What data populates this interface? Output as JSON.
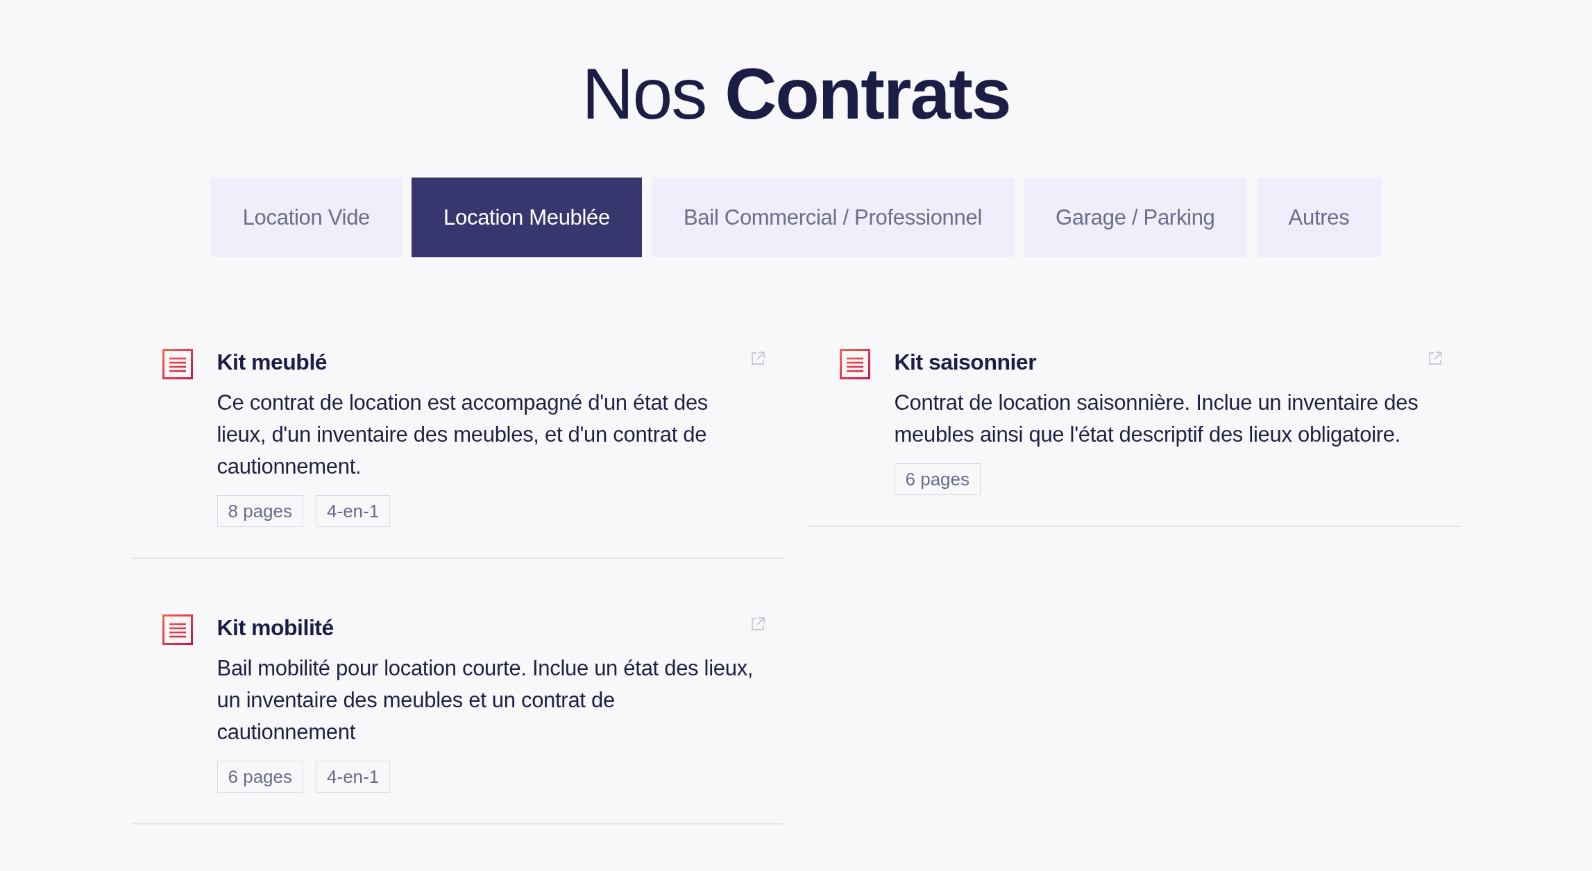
{
  "page": {
    "title": "Nos **Contrats**"
  },
  "tabs": [
    {
      "label": "Location Vide",
      "selected": false
    },
    {
      "label": "Location Meublée",
      "selected": true
    },
    {
      "label": "Bail Commercial / Professionnel",
      "selected": false
    },
    {
      "label": "Garage / Parking",
      "selected": false
    },
    {
      "label": "Autres",
      "selected": false
    }
  ],
  "contracts": [
    {
      "title": "Kit meublé",
      "description": "Ce contrat de location est accompagné d'un état des lieux, d'un inventaire des meubles, et d'un contrat de cautionnement.",
      "tags": [
        "8 pages",
        "4-en-1"
      ]
    },
    {
      "title": "Kit saisonnier",
      "description": "Contrat de location saisonnière. Inclue un inventaire des meubles ainsi que l'état descriptif des lieux obligatoire.",
      "tags": [
        "6 pages"
      ]
    },
    {
      "title": "Kit mobilité",
      "description": "Bail mobilité pour location courte. Inclue un état des lieux, un inventaire des meubles et un contrat de cautionnement",
      "tags": [
        "6 pages",
        "4-en-1"
      ]
    }
  ]
}
